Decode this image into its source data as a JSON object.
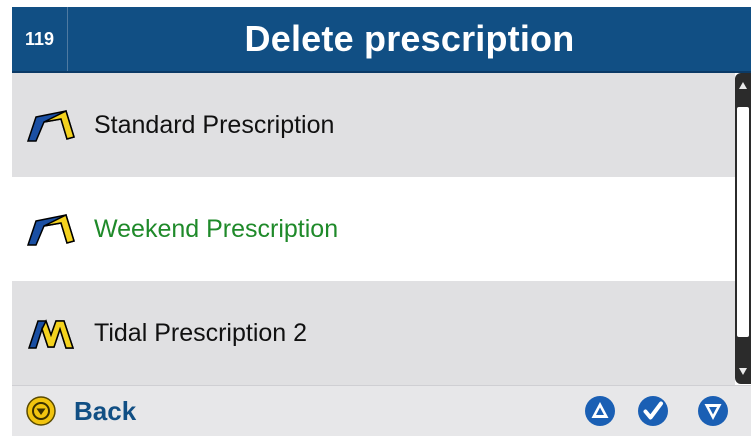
{
  "header": {
    "screen_number": "119",
    "title": "Delete prescription"
  },
  "list": {
    "items": [
      {
        "label": "Standard Prescription",
        "icon": "standard-prescription-icon",
        "selected": false
      },
      {
        "label": "Weekend Prescription",
        "icon": "standard-prescription-icon",
        "selected": true
      },
      {
        "label": "Tidal Prescription 2",
        "icon": "tidal-prescription-icon",
        "selected": false
      }
    ]
  },
  "footer": {
    "back_label": "Back"
  },
  "colors": {
    "header_bg": "#114f84",
    "selected_text": "#1f8a2a",
    "accent_blue": "#1a4fa3",
    "accent_yellow": "#f4d21e"
  }
}
